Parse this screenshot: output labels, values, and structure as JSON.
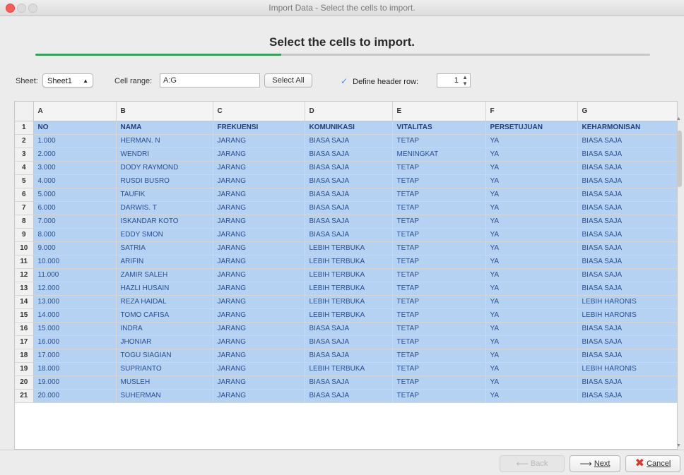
{
  "window": {
    "title": "Import Data - Select the cells to import."
  },
  "heading": "Select the cells to import.",
  "wizard_progress": 0.4,
  "controls": {
    "sheet_label": "Sheet:",
    "sheet_value": "Sheet1",
    "range_label": "Cell range:",
    "range_value": "A:G",
    "select_all": "Select All",
    "define_header_label": "Define header row:",
    "define_header_checked": true,
    "header_row": "1"
  },
  "grid": {
    "columns": [
      "A",
      "B",
      "C",
      "D",
      "E",
      "F",
      "G"
    ],
    "rows": [
      [
        "NO",
        "NAMA",
        "FREKUENSI",
        "KOMUNIKASI",
        "VITALITAS",
        "PERSETUJUAN",
        "KEHARMONISAN"
      ],
      [
        "1.000",
        "HERMAN. N",
        "JARANG",
        "BIASA SAJA",
        "TETAP",
        "YA",
        "BIASA SAJA"
      ],
      [
        "2.000",
        "WENDRI",
        "JARANG",
        "BIASA SAJA",
        "MENINGKAT",
        "YA",
        "BIASA SAJA"
      ],
      [
        "3.000",
        "DODY RAYMOND",
        "JARANG",
        "BIASA SAJA",
        "TETAP",
        "YA",
        "BIASA SAJA"
      ],
      [
        "4.000",
        "RUSDI BUSRO",
        "JARANG",
        "BIASA SAJA",
        "TETAP",
        "YA",
        "BIASA SAJA"
      ],
      [
        "5.000",
        "TAUFIK",
        "JARANG",
        "BIASA SAJA",
        "TETAP",
        "YA",
        "BIASA SAJA"
      ],
      [
        "6.000",
        "DARWIS. T",
        "JARANG",
        "BIASA SAJA",
        "TETAP",
        "YA",
        "BIASA SAJA"
      ],
      [
        "7.000",
        "ISKANDAR KOTO",
        "JARANG",
        "BIASA SAJA",
        "TETAP",
        "YA",
        "BIASA SAJA"
      ],
      [
        "8.000",
        "EDDY SMON",
        "JARANG",
        "BIASA SAJA",
        "TETAP",
        "YA",
        "BIASA SAJA"
      ],
      [
        "9.000",
        "SATRIA",
        "JARANG",
        "LEBIH TERBUKA",
        "TETAP",
        "YA",
        "BIASA SAJA"
      ],
      [
        "10.000",
        "ARIFIN",
        "JARANG",
        "LEBIH TERBUKA",
        "TETAP",
        "YA",
        "BIASA SAJA"
      ],
      [
        "11.000",
        "ZAMIR SALEH",
        "JARANG",
        "LEBIH TERBUKA",
        "TETAP",
        "YA",
        "BIASA SAJA"
      ],
      [
        "12.000",
        "HAZLI HUSAIN",
        "JARANG",
        "LEBIH TERBUKA",
        "TETAP",
        "YA",
        "BIASA SAJA"
      ],
      [
        "13.000",
        "REZA HAIDAL",
        "JARANG",
        "LEBIH TERBUKA",
        "TETAP",
        "YA",
        "LEBIH HARONIS"
      ],
      [
        "14.000",
        "TOMO CAFISA",
        "JARANG",
        "LEBIH TERBUKA",
        "TETAP",
        "YA",
        "LEBIH HARONIS"
      ],
      [
        "15.000",
        "INDRA",
        "JARANG",
        "BIASA SAJA",
        "TETAP",
        "YA",
        "BIASA SAJA"
      ],
      [
        "16.000",
        "JHONIAR",
        "JARANG",
        "BIASA SAJA",
        "TETAP",
        "YA",
        "BIASA SAJA"
      ],
      [
        "17.000",
        "TOGU SIAGIAN",
        "JARANG",
        "BIASA SAJA",
        "TETAP",
        "YA",
        "BIASA SAJA"
      ],
      [
        "18.000",
        "SUPRIANTO",
        "JARANG",
        "LEBIH TERBUKA",
        "TETAP",
        "YA",
        "LEBIH HARONIS"
      ],
      [
        "19.000",
        "MUSLEH",
        "JARANG",
        "BIASA SAJA",
        "TETAP",
        "YA",
        "BIASA SAJA"
      ],
      [
        "20.000",
        "SUHERMAN",
        "JARANG",
        "BIASA SAJA",
        "TETAP",
        "YA",
        "BIASA SAJA"
      ]
    ]
  },
  "footer": {
    "back_label": "Back",
    "next_label": "Next",
    "cancel_label": "Cancel"
  },
  "colors": {
    "selection": "#b5d2f3",
    "progress": "#35a35a",
    "cancel_icon": "#d23b2b"
  },
  "icons": {
    "back": "arrow-left-icon",
    "next": "arrow-right-icon",
    "cancel": "close-x-icon",
    "checkbox": "checkmark-icon",
    "select": "chevron-updown-icon",
    "spinner": "stepper-icon"
  }
}
